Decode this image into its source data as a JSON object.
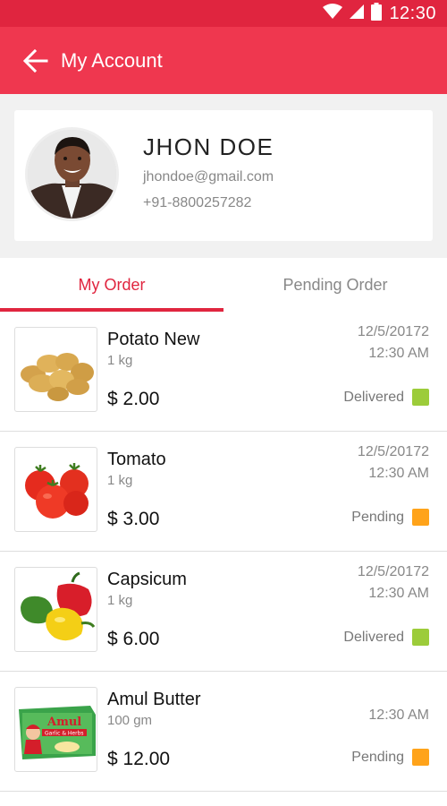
{
  "status_bar": {
    "time": "12:30",
    "icons": [
      "wifi-icon",
      "signal-icon",
      "battery-icon"
    ]
  },
  "app_bar": {
    "title": "My Account",
    "back_icon": "arrow-left-icon"
  },
  "profile": {
    "name": "JHON DOE",
    "email": "jhondoe@gmail.com",
    "phone": "+91-8800257282"
  },
  "tabs": [
    {
      "label": "My Order",
      "active": true
    },
    {
      "label": "Pending Order",
      "active": false
    }
  ],
  "colors": {
    "primary": "#ef374f",
    "status_bar": "#e0253f",
    "delivered": "#9ccc3a",
    "pending": "#ffa31a"
  },
  "orders": [
    {
      "name": "Potato New",
      "qty": "1 kg",
      "price": "$ 2.00",
      "date": "12/5/20172",
      "time": "12:30 AM",
      "status": "Delivered",
      "image": "potato"
    },
    {
      "name": "Tomato",
      "qty": "1 kg",
      "price": "$ 3.00",
      "date": "12/5/20172",
      "time": "12:30 AM",
      "status": "Pending",
      "image": "tomato"
    },
    {
      "name": "Capsicum",
      "qty": "1 kg",
      "price": "$ 6.00",
      "date": "12/5/20172",
      "time": "12:30 AM",
      "status": "Delivered",
      "image": "capsicum"
    },
    {
      "name": "Amul Butter",
      "qty": "100 gm",
      "price": "$ 12.00",
      "date": "",
      "time": "12:30 AM",
      "status": "Pending",
      "image": "butter",
      "logo_text": "Amul",
      "logo_subtext": "Garlic & Herbs"
    }
  ]
}
